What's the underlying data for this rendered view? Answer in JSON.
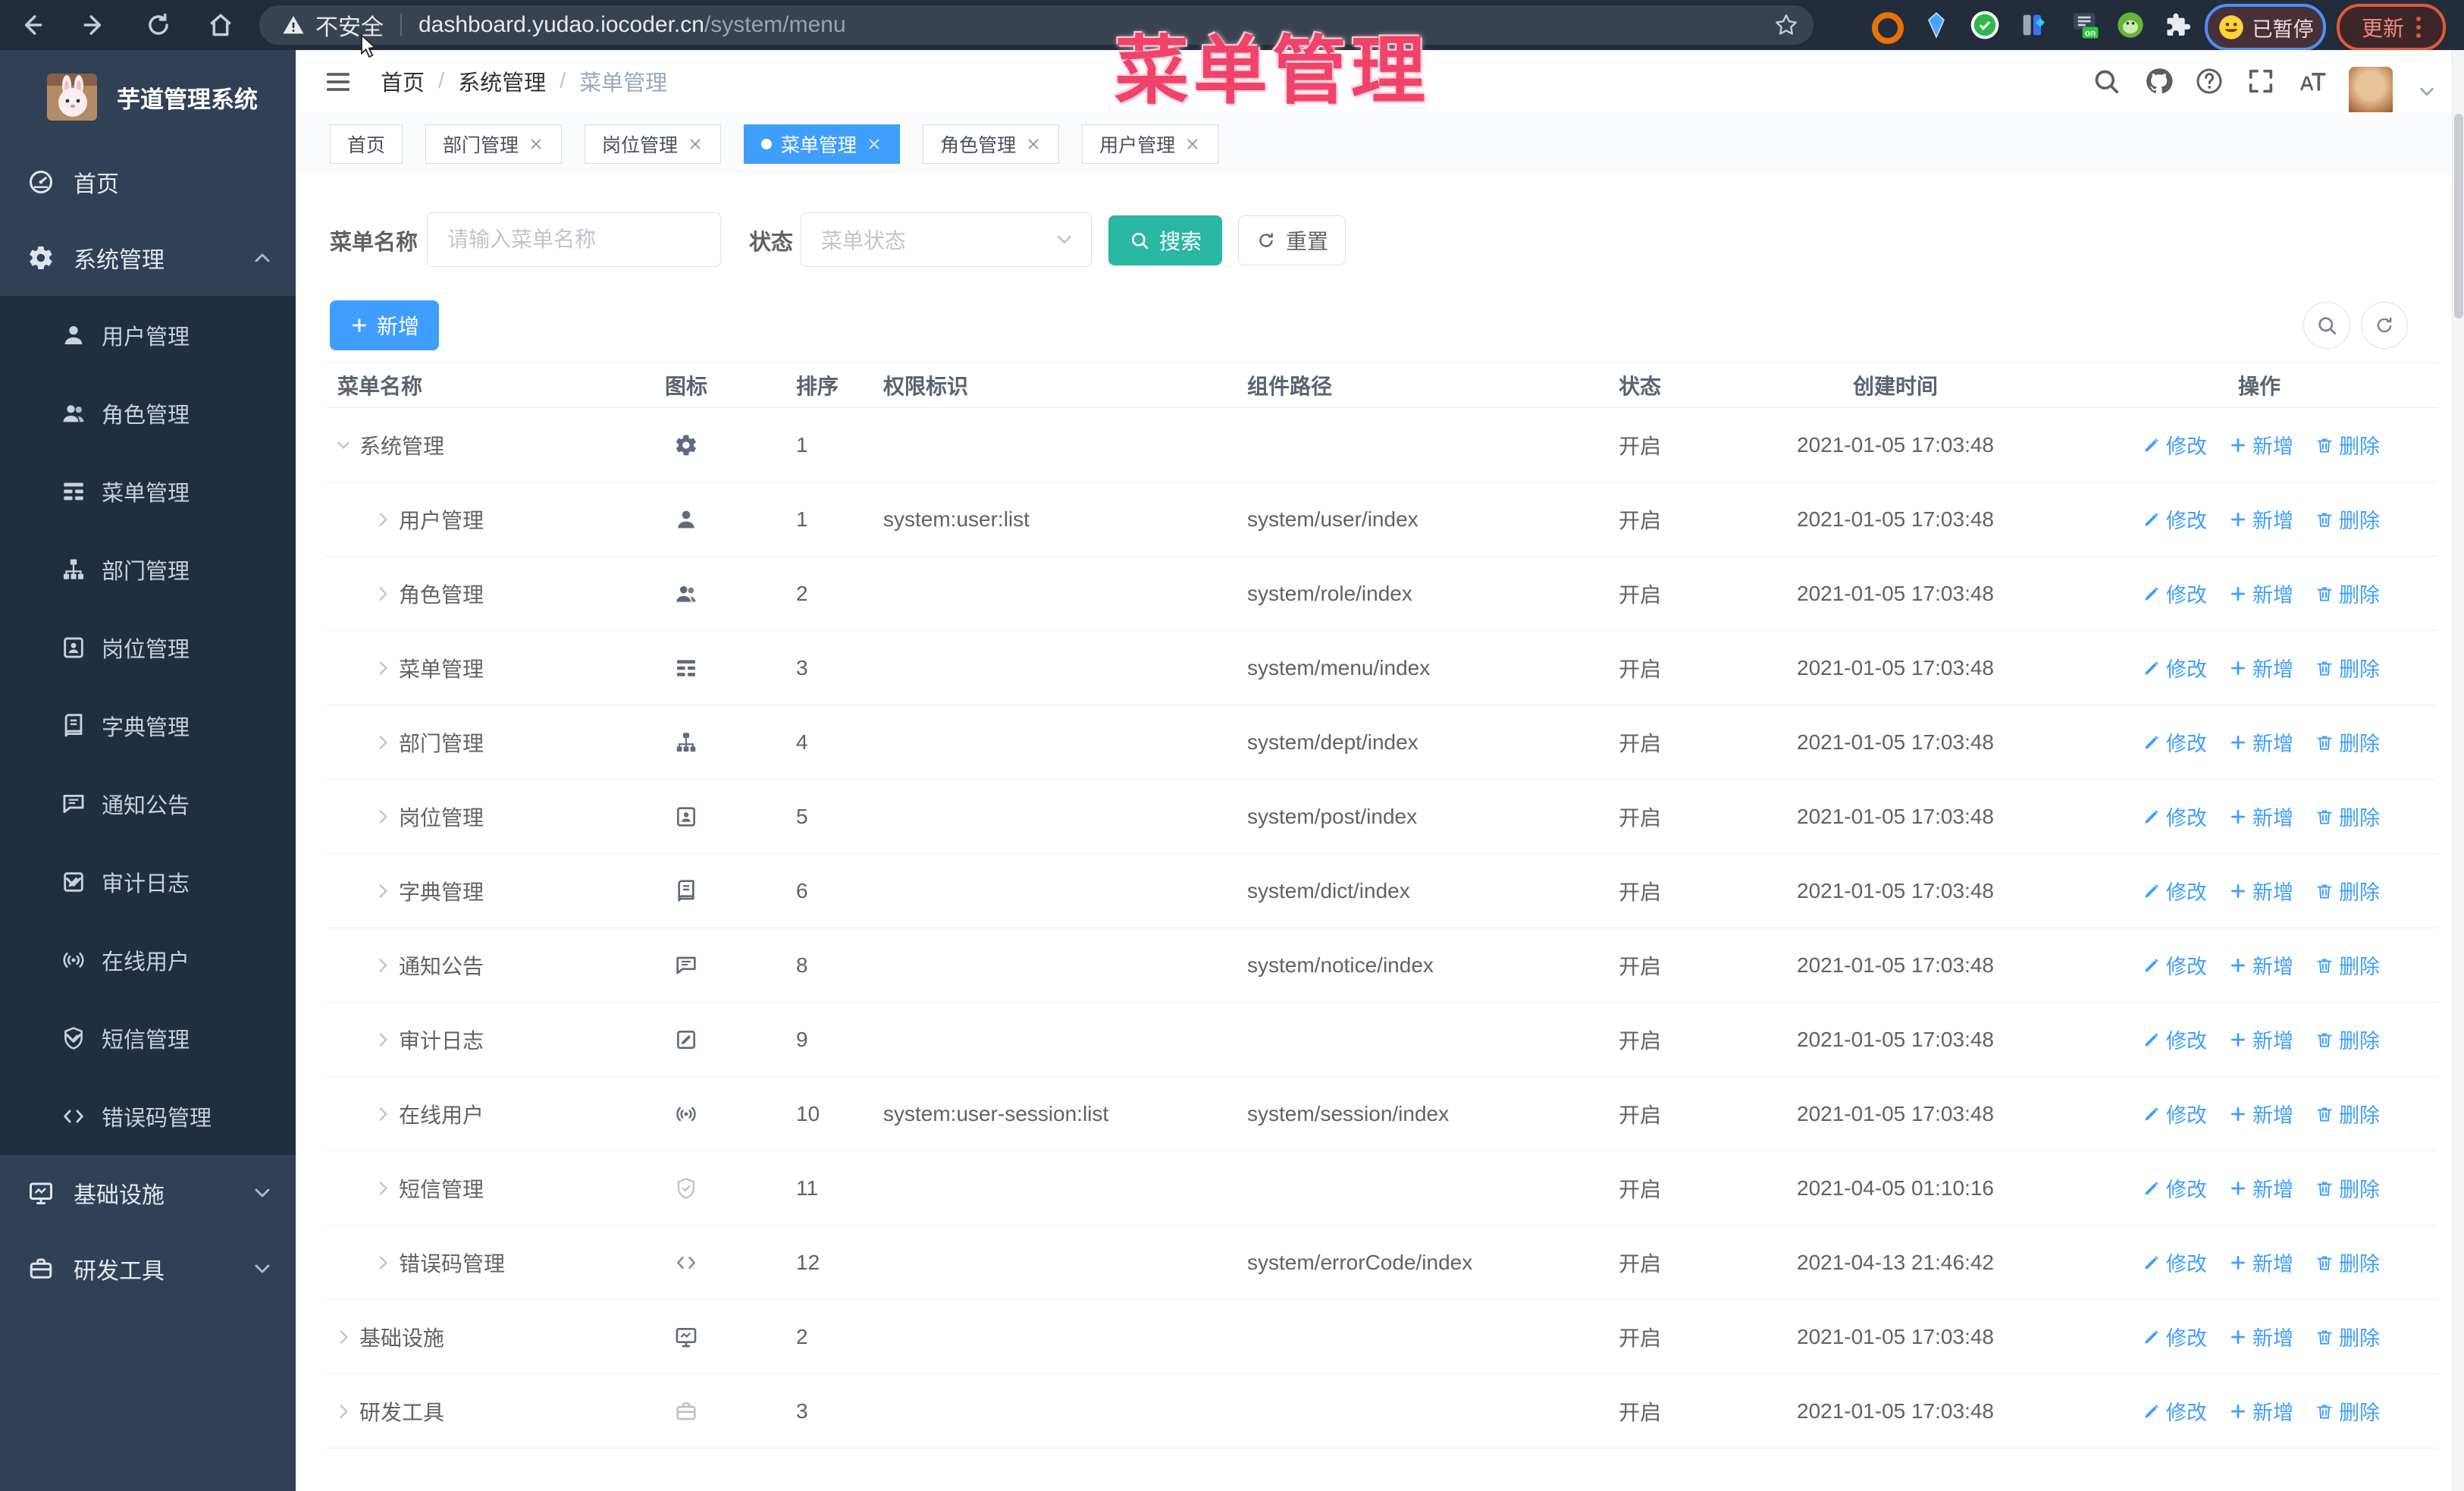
{
  "browser": {
    "security_label": "不安全",
    "url_host": "dashboard.yudao.iocoder.cn",
    "url_path": "/system/menu",
    "paused_badge": "已暂停",
    "update_button": "更新"
  },
  "overlay_title": "菜单管理",
  "sidebar": {
    "app_title": "芋道管理系统",
    "items": [
      {
        "label": "首页",
        "icon": "dashboard-icon",
        "type": "top"
      },
      {
        "label": "系统管理",
        "icon": "gear-icon",
        "type": "top",
        "arrow": "up",
        "expanded": true
      },
      {
        "label": "用户管理",
        "icon": "user-icon",
        "type": "sub"
      },
      {
        "label": "角色管理",
        "icon": "users-icon",
        "type": "sub"
      },
      {
        "label": "菜单管理",
        "icon": "tree-table-icon",
        "type": "sub",
        "active": true
      },
      {
        "label": "部门管理",
        "icon": "tree-icon",
        "type": "sub"
      },
      {
        "label": "岗位管理",
        "icon": "badge-icon",
        "type": "sub"
      },
      {
        "label": "字典管理",
        "icon": "dict-icon",
        "type": "sub"
      },
      {
        "label": "通知公告",
        "icon": "message-icon",
        "type": "sub"
      },
      {
        "label": "审计日志",
        "icon": "log-icon",
        "type": "sub",
        "arrow": "down"
      },
      {
        "label": "在线用户",
        "icon": "online-icon",
        "type": "sub"
      },
      {
        "label": "短信管理",
        "icon": "sms-icon",
        "type": "sub",
        "arrow": "down"
      },
      {
        "label": "错误码管理",
        "icon": "code-icon",
        "type": "sub"
      },
      {
        "label": "基础设施",
        "icon": "monitor-icon",
        "type": "top",
        "arrow": "down"
      },
      {
        "label": "研发工具",
        "icon": "tool-icon",
        "type": "top",
        "arrow": "down"
      }
    ]
  },
  "header": {
    "breadcrumb": [
      "首页",
      "系统管理",
      "菜单管理"
    ]
  },
  "tags": [
    {
      "label": "首页",
      "closable": false,
      "active": false
    },
    {
      "label": "部门管理",
      "closable": true,
      "active": false
    },
    {
      "label": "岗位管理",
      "closable": true,
      "active": false
    },
    {
      "label": "菜单管理",
      "closable": true,
      "active": true
    },
    {
      "label": "角色管理",
      "closable": true,
      "active": false
    },
    {
      "label": "用户管理",
      "closable": true,
      "active": false
    }
  ],
  "filters": {
    "name_label": "菜单名称",
    "name_placeholder": "请输入菜单名称",
    "status_label": "状态",
    "status_placeholder": "菜单状态",
    "search_button": "搜索",
    "reset_button": "重置"
  },
  "toolbar": {
    "add_button": "新增"
  },
  "table": {
    "columns": [
      "菜单名称",
      "图标",
      "排序",
      "权限标识",
      "组件路径",
      "状态",
      "创建时间",
      "操作"
    ],
    "ops": {
      "edit": "修改",
      "add": "新增",
      "delete": "删除"
    },
    "rows": [
      {
        "name": "系统管理",
        "level": 0,
        "expanded": true,
        "icon": "gear-icon",
        "sort": "1",
        "perm": "",
        "path": "",
        "status": "开启",
        "time": "2021-01-05 17:03:48"
      },
      {
        "name": "用户管理",
        "level": 1,
        "icon": "user-icon",
        "sort": "1",
        "perm": "system:user:list",
        "path": "system/user/index",
        "status": "开启",
        "time": "2021-01-05 17:03:48"
      },
      {
        "name": "角色管理",
        "level": 1,
        "icon": "users-icon",
        "sort": "2",
        "perm": "",
        "path": "system/role/index",
        "status": "开启",
        "time": "2021-01-05 17:03:48"
      },
      {
        "name": "菜单管理",
        "level": 1,
        "icon": "tree-table-icon",
        "sort": "3",
        "perm": "",
        "path": "system/menu/index",
        "status": "开启",
        "time": "2021-01-05 17:03:48"
      },
      {
        "name": "部门管理",
        "level": 1,
        "icon": "tree-icon",
        "sort": "4",
        "perm": "",
        "path": "system/dept/index",
        "status": "开启",
        "time": "2021-01-05 17:03:48"
      },
      {
        "name": "岗位管理",
        "level": 1,
        "icon": "badge-icon",
        "sort": "5",
        "perm": "",
        "path": "system/post/index",
        "status": "开启",
        "time": "2021-01-05 17:03:48"
      },
      {
        "name": "字典管理",
        "level": 1,
        "icon": "dict-icon",
        "sort": "6",
        "perm": "",
        "path": "system/dict/index",
        "status": "开启",
        "time": "2021-01-05 17:03:48"
      },
      {
        "name": "通知公告",
        "level": 1,
        "icon": "message-icon",
        "sort": "8",
        "perm": "",
        "path": "system/notice/index",
        "status": "开启",
        "time": "2021-01-05 17:03:48"
      },
      {
        "name": "审计日志",
        "level": 1,
        "icon": "log-icon",
        "sort": "9",
        "perm": "",
        "path": "",
        "status": "开启",
        "time": "2021-01-05 17:03:48"
      },
      {
        "name": "在线用户",
        "level": 1,
        "icon": "online-icon",
        "sort": "10",
        "perm": "system:user-session:list",
        "path": "system/session/index",
        "status": "开启",
        "time": "2021-01-05 17:03:48"
      },
      {
        "name": "短信管理",
        "level": 1,
        "icon": "sms-icon",
        "sort": "11",
        "perm": "",
        "path": "",
        "status": "开启",
        "time": "2021-04-05 01:10:16"
      },
      {
        "name": "错误码管理",
        "level": 1,
        "icon": "code-icon",
        "sort": "12",
        "perm": "",
        "path": "system/errorCode/index",
        "status": "开启",
        "time": "2021-04-13 21:46:42"
      },
      {
        "name": "基础设施",
        "level": 0,
        "expanded": false,
        "icon": "monitor-icon",
        "sort": "2",
        "perm": "",
        "path": "",
        "status": "开启",
        "time": "2021-01-05 17:03:48"
      },
      {
        "name": "研发工具",
        "level": 0,
        "expanded": false,
        "icon": "tool-icon",
        "sort": "3",
        "perm": "",
        "path": "",
        "status": "开启",
        "time": "2021-01-05 17:03:48"
      }
    ]
  },
  "colors": {
    "accent": "#409eff",
    "search_button": "#2ab7a3",
    "overlay_title": "#f0436a",
    "sidebar_bg": "#304156",
    "submenu_bg": "#202f3f",
    "active_text": "#409eff"
  }
}
